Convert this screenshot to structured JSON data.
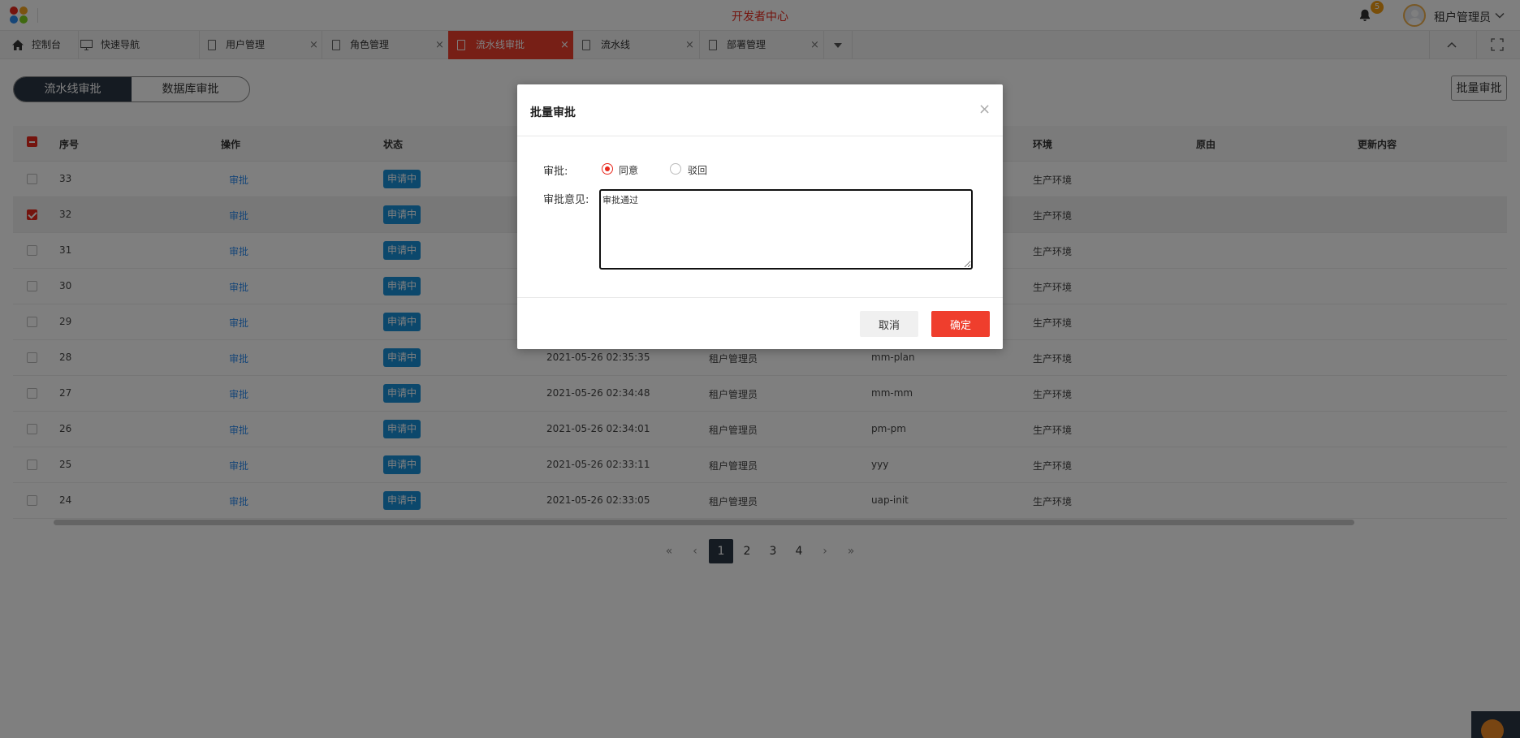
{
  "header": {
    "title": "开发者中心",
    "notification_count": "5",
    "username": "租户管理员"
  },
  "tabs": [
    {
      "label": "控制台",
      "icon": "home-icon",
      "closable": false,
      "active": false
    },
    {
      "label": "快速导航",
      "icon": "monitor-icon",
      "closable": false,
      "active": false
    },
    {
      "label": "用户管理",
      "icon": "document-icon",
      "closable": true,
      "active": false
    },
    {
      "label": "角色管理",
      "icon": "document-icon",
      "closable": true,
      "active": false
    },
    {
      "label": "流水线审批",
      "icon": "document-icon",
      "closable": true,
      "active": true
    },
    {
      "label": "流水线",
      "icon": "document-icon",
      "closable": true,
      "active": false
    },
    {
      "label": "部署管理",
      "icon": "document-icon",
      "closable": true,
      "active": false
    }
  ],
  "segments": {
    "pipeline": "流水线审批",
    "database": "数据库审批"
  },
  "toolbar": {
    "batch_label": "批量审批"
  },
  "table": {
    "columns": {
      "index": "序号",
      "action": "操作",
      "status": "状态",
      "env": "环境",
      "reason": "原由",
      "update": "更新内容"
    },
    "rows": [
      {
        "id": "33",
        "action": "审批",
        "status": "申请中",
        "time": "",
        "user": "",
        "app": "",
        "env": "生产环境",
        "checked": false
      },
      {
        "id": "32",
        "action": "审批",
        "status": "申请中",
        "time": "",
        "user": "",
        "app": "",
        "env": "生产环境",
        "checked": true
      },
      {
        "id": "31",
        "action": "审批",
        "status": "申请中",
        "time": "",
        "user": "",
        "app": "",
        "env": "生产环境",
        "checked": false
      },
      {
        "id": "30",
        "action": "审批",
        "status": "申请中",
        "time": "",
        "user": "",
        "app": "",
        "env": "生产环境",
        "checked": false
      },
      {
        "id": "29",
        "action": "审批",
        "status": "申请中",
        "time": "",
        "user": "",
        "app": "",
        "env": "生产环境",
        "checked": false
      },
      {
        "id": "28",
        "action": "审批",
        "status": "申请中",
        "time": "2021-05-26 02:35:35",
        "user": "租户管理员",
        "app": "mm-plan",
        "env": "生产环境",
        "checked": false
      },
      {
        "id": "27",
        "action": "审批",
        "status": "申请中",
        "time": "2021-05-26 02:34:48",
        "user": "租户管理员",
        "app": "mm-mm",
        "env": "生产环境",
        "checked": false
      },
      {
        "id": "26",
        "action": "审批",
        "status": "申请中",
        "time": "2021-05-26 02:34:01",
        "user": "租户管理员",
        "app": "pm-pm",
        "env": "生产环境",
        "checked": false
      },
      {
        "id": "25",
        "action": "审批",
        "status": "申请中",
        "time": "2021-05-26 02:33:11",
        "user": "租户管理员",
        "app": "yyy",
        "env": "生产环境",
        "checked": false
      },
      {
        "id": "24",
        "action": "审批",
        "status": "申请中",
        "time": "2021-05-26 02:33:05",
        "user": "租户管理员",
        "app": "uap-init",
        "env": "生产环境",
        "checked": false
      }
    ]
  },
  "pagination": {
    "first": "«",
    "prev": "‹",
    "pages": [
      "1",
      "2",
      "3",
      "4"
    ],
    "current": "1",
    "next": "›",
    "last": "»"
  },
  "modal": {
    "title": "批量审批",
    "close": "×",
    "approval_label": "审批:",
    "option_agree": "同意",
    "option_reject": "驳回",
    "selected": "agree",
    "opinion_label": "审批意见:",
    "opinion_value": "审批通过",
    "cancel_label": "取消",
    "ok_label": "确定"
  },
  "colors": {
    "accent": "#ef3e2d",
    "dark": "#2b3645",
    "tag": "#1890d8",
    "link": "#2d8cf0"
  }
}
